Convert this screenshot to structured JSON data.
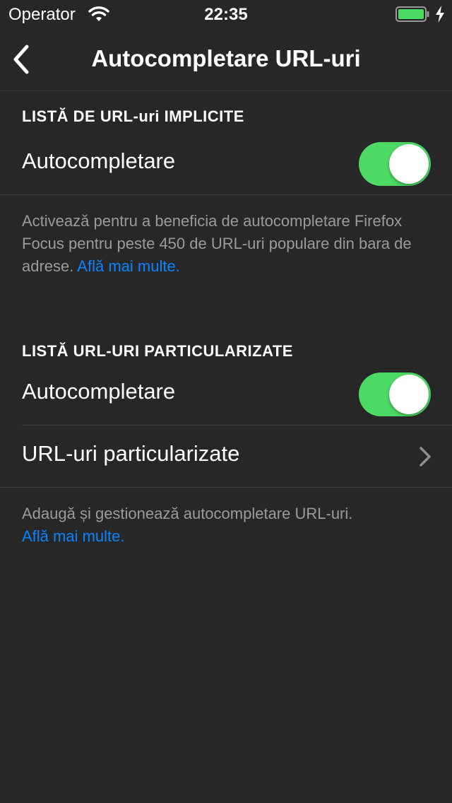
{
  "status_bar": {
    "carrier": "Operator",
    "time": "22:35",
    "wifi_icon": "wifi-icon",
    "battery_icon": "battery-full-icon",
    "charging_icon": "charging-bolt-icon",
    "battery_color": "#4cd964"
  },
  "nav": {
    "back_icon": "chevron-left-icon",
    "title": "Autocompletare URL-uri"
  },
  "sections": [
    {
      "header": "LISTĂ DE URL-uri IMPLICITE",
      "rows": [
        {
          "label": "Autocompletare",
          "toggle_on": true
        }
      ],
      "footer_text": "Activează pentru a beneficia de autocompletare Firefox Focus pentru peste 450 de URL-uri populare din bara de adrese.",
      "footer_link": "Află mai multe."
    },
    {
      "header": "LISTĂ URL-URI PARTICULARIZATE",
      "rows": [
        {
          "label": "Autocompletare",
          "toggle_on": true
        },
        {
          "label": "URL-uri particularizate",
          "accessory_icon": "chevron-right-icon"
        }
      ],
      "footer_text": "Adaugă și gestionează autocompletare URL-uri.",
      "footer_link": "Află mai multe."
    }
  ],
  "colors": {
    "background": "#272727",
    "toggle_on": "#4cd964",
    "link": "#0a84ff",
    "footnote": "#9b9b9b"
  }
}
